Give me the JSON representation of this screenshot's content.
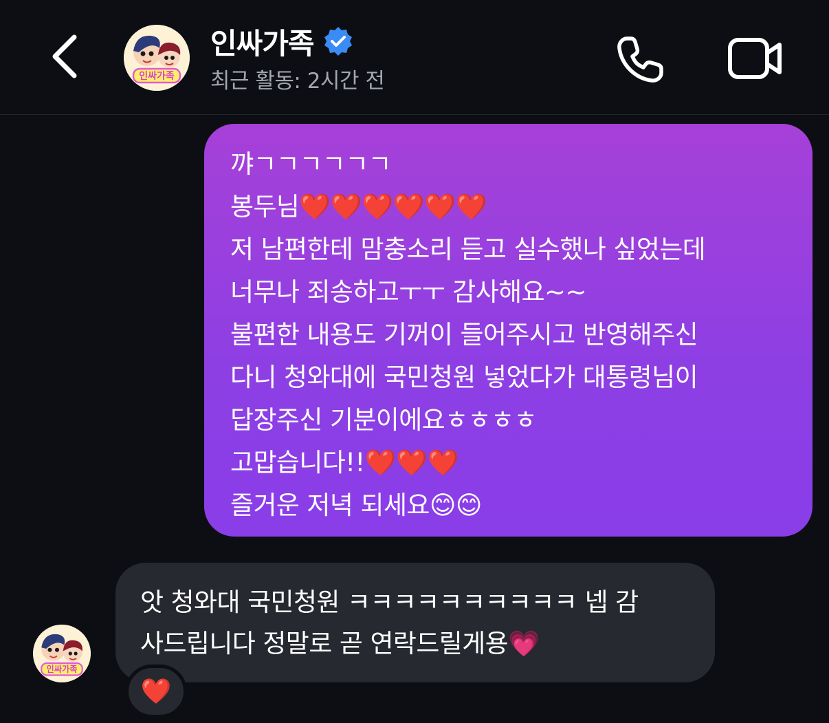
{
  "header": {
    "back_icon": "chevron-left-icon",
    "avatar_text": "인싸가족",
    "title": "인싸가족",
    "verified_icon": "verified-badge-icon",
    "subtitle": "최근 활동: 2시간 전",
    "call_icon": "phone-icon",
    "video_icon": "video-camera-icon"
  },
  "messages": [
    {
      "direction": "outgoing",
      "lines": [
        "꺄ㄱㄱㄱㄱㄱㄱ",
        "봉두님❤️❤️❤️❤️❤️❤️",
        "저 남편한테 맘충소리 듣고 실수했나 싶었는데",
        "너무나 죄송하고ㅜㅜ 감사해요~~",
        "불편한 내용도 기꺼이 들어주시고 반영해주신",
        "다니 청와대에 국민청원 넣었다가 대통령님이",
        "답장주신 기분이에요ㅎㅎㅎㅎ",
        "고맙습니다!!❤️❤️❤️",
        "즐거운 저녁 되세요😊😊"
      ]
    },
    {
      "direction": "incoming",
      "lines": [
        "앗 청와대 국민청원 ㅋㅋㅋㅋㅋㅋㅋㅋㅋㅋ 넵 감",
        "사드립니다 정말로 곧 연락드릴게용💗"
      ],
      "reaction": "❤️"
    }
  ],
  "colors": {
    "background": "#0c0e13",
    "outgoing_bubble_top": "#a640d8",
    "outgoing_bubble_bottom": "#8a3ee8",
    "incoming_bubble": "#262930",
    "verified_badge": "#3b8bf5",
    "subtitle_text": "#a3a7b0"
  }
}
